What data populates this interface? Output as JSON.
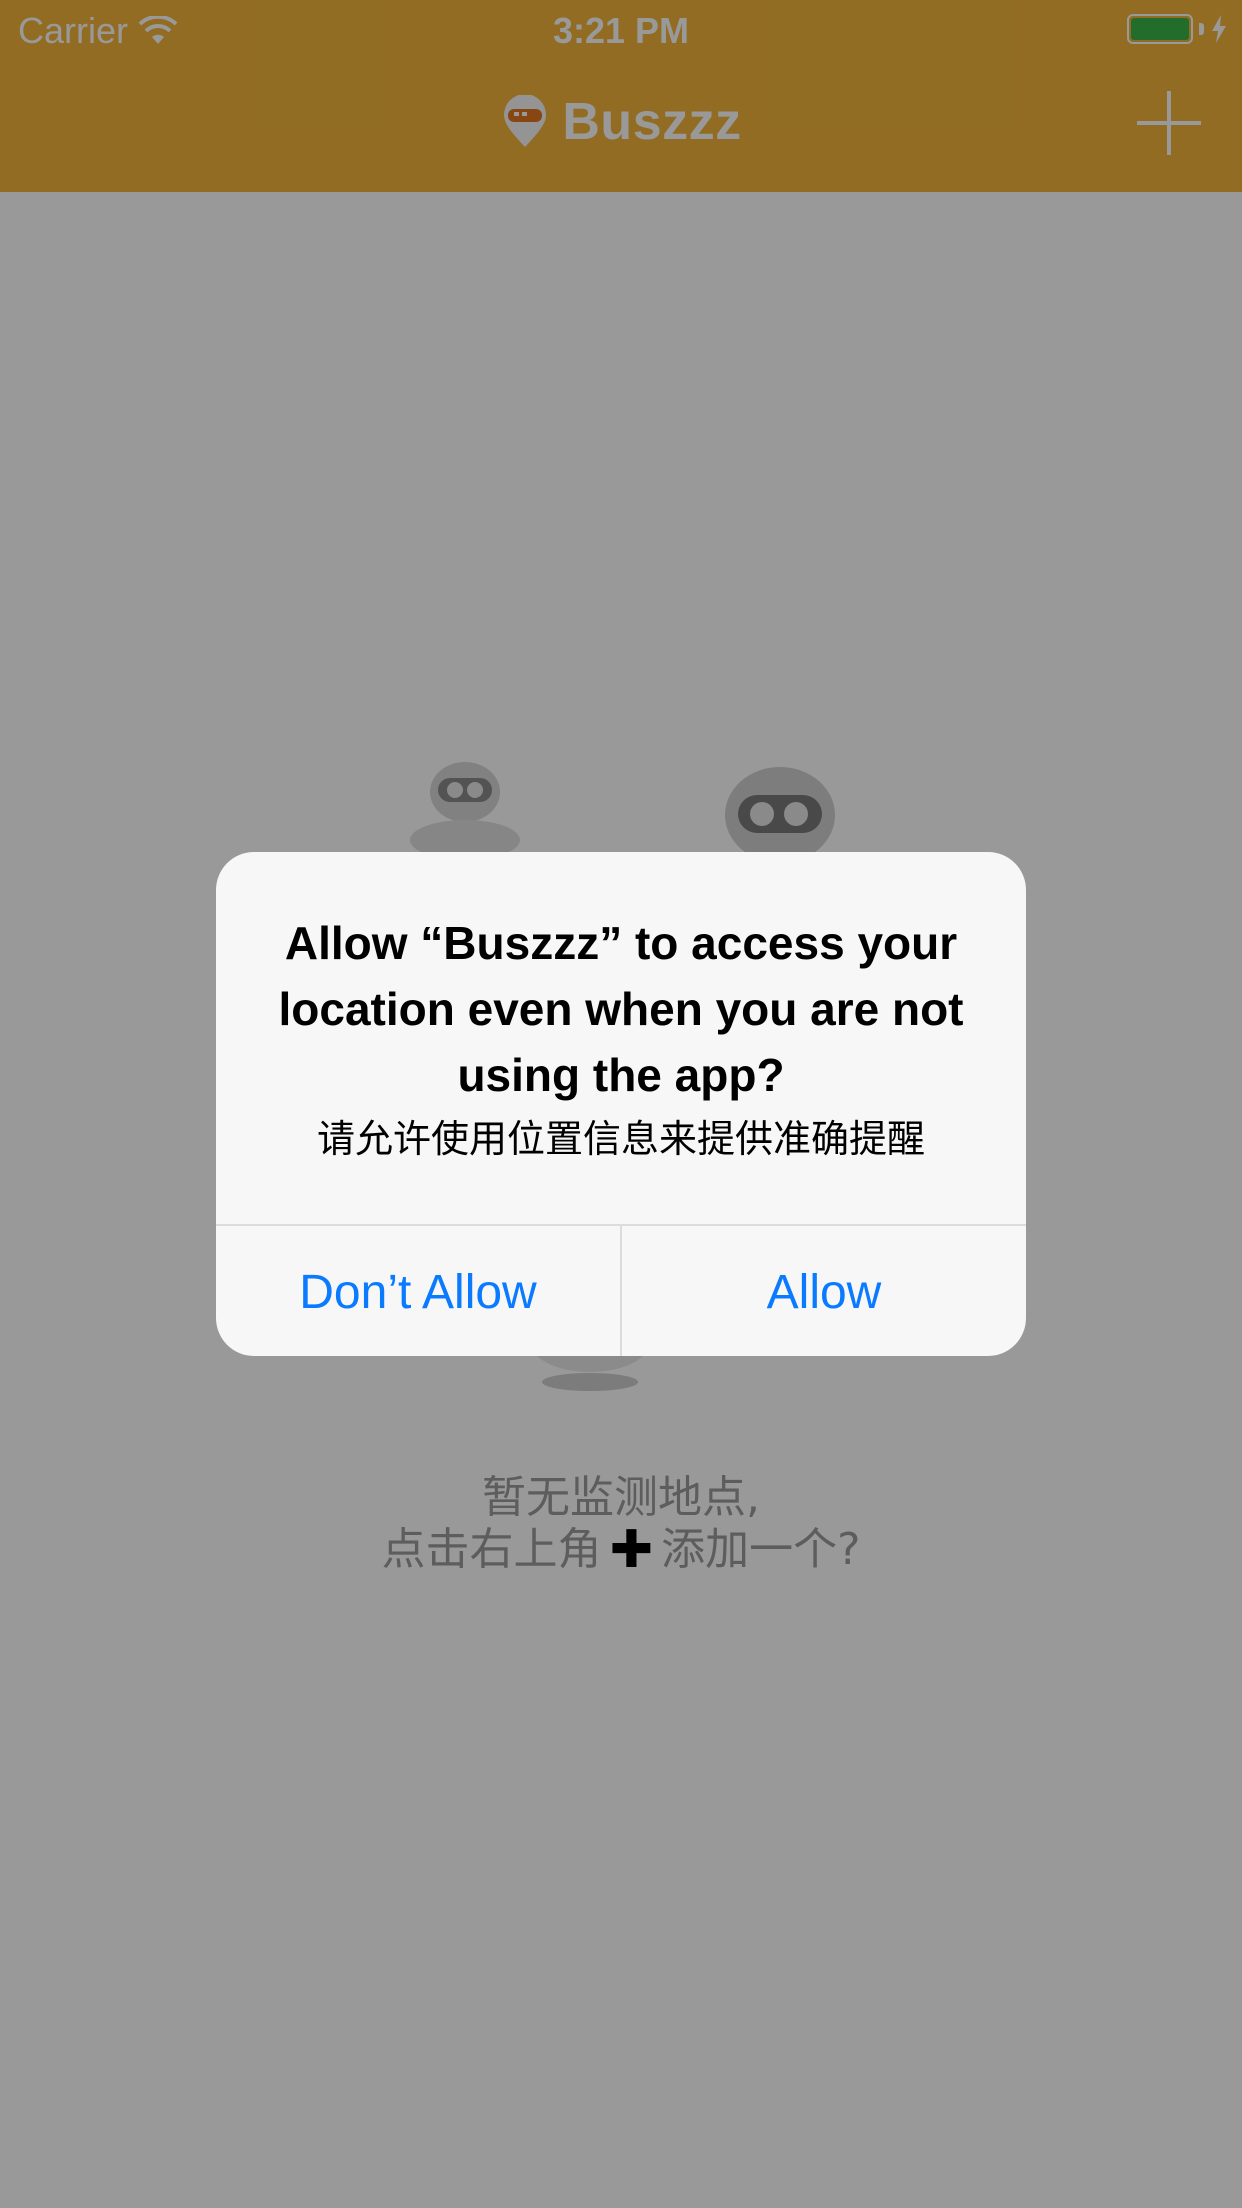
{
  "status_bar": {
    "carrier": "Carrier",
    "time": "3:21 PM",
    "battery_color": "#3AB54A"
  },
  "nav": {
    "title": "Buszzz",
    "logo_icon": "bus-pin-logo-icon",
    "add_icon": "plus-icon",
    "bar_color": "#F2B43A"
  },
  "empty_state": {
    "line1": "暂无监测地点,",
    "line2_prefix": "点击右上角",
    "line2_plus": "✚",
    "line2_suffix": "添加一个?"
  },
  "alert": {
    "title": "Allow “Buszzz” to access your location even when you are not using the app?",
    "message": "请允许使用位置信息来提供准确提醒",
    "dont_allow_label": "Don’t Allow",
    "allow_label": "Allow",
    "button_color": "#0A7AFF"
  }
}
